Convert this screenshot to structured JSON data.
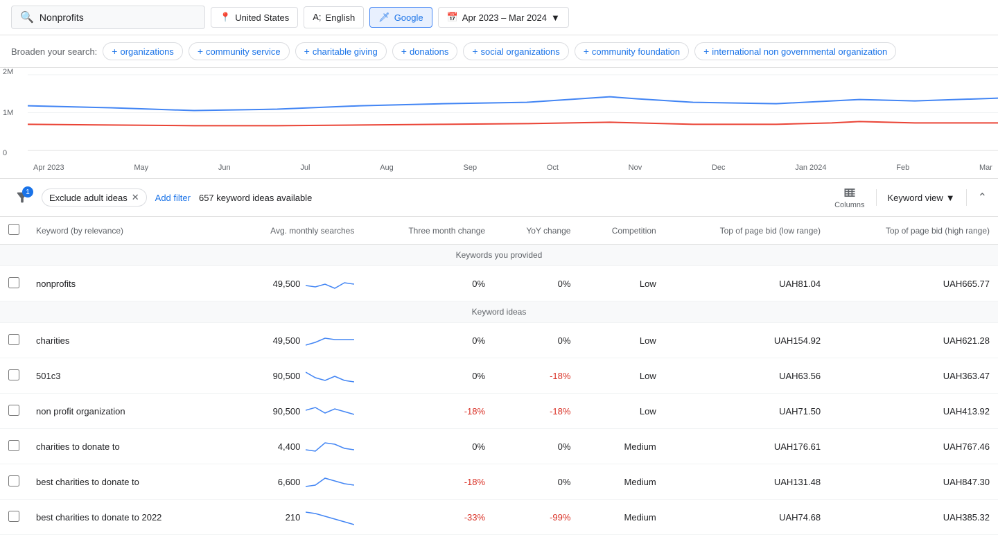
{
  "topbar": {
    "search_placeholder": "Nonprofits",
    "location": "United States",
    "language": "English",
    "platform": "Google",
    "date_range": "Apr 2023 – Mar 2024"
  },
  "broaden": {
    "label": "Broaden your search:",
    "chips": [
      "organizations",
      "community service",
      "charitable giving",
      "donations",
      "social organizations",
      "community foundation",
      "international non governmental organization"
    ]
  },
  "chart": {
    "y_labels": [
      "2M",
      "1M",
      "0"
    ],
    "x_labels": [
      "Apr 2023",
      "May",
      "Jun",
      "Jul",
      "Aug",
      "Sep",
      "Oct",
      "Nov",
      "Dec",
      "Jan 2024",
      "Feb",
      "Mar"
    ]
  },
  "toolbar": {
    "filter_badge": "1",
    "exclude_label": "Exclude adult ideas",
    "add_filter_label": "Add filter",
    "keyword_count": "657 keyword ideas available",
    "columns_label": "Columns",
    "keyword_view_label": "Keyword view"
  },
  "table": {
    "headers": [
      "",
      "Keyword (by relevance)",
      "Avg. monthly searches",
      "Three month change",
      "YoY change",
      "Competition",
      "Top of page bid (low range)",
      "Top of page bid (high range)"
    ],
    "section_provided": "Keywords you provided",
    "section_ideas": "Keyword ideas",
    "rows_provided": [
      {
        "keyword": "nonprofits",
        "avg_monthly": "49,500",
        "three_month": "0%",
        "yoy": "0%",
        "competition": "Low",
        "bid_low": "UAH81.04",
        "bid_high": "UAH665.77",
        "trend": "flat_slight"
      }
    ],
    "rows_ideas": [
      {
        "keyword": "charities",
        "avg_monthly": "49,500",
        "three_month": "0%",
        "yoy": "0%",
        "competition": "Low",
        "bid_low": "UAH154.92",
        "bid_high": "UAH621.28",
        "trend": "rise_flat"
      },
      {
        "keyword": "501c3",
        "avg_monthly": "90,500",
        "three_month": "0%",
        "yoy": "-18%",
        "competition": "Low",
        "bid_low": "UAH63.56",
        "bid_high": "UAH363.47",
        "trend": "down_slight"
      },
      {
        "keyword": "non profit organization",
        "avg_monthly": "90,500",
        "three_month": "-18%",
        "yoy": "-18%",
        "competition": "Low",
        "bid_low": "UAH71.50",
        "bid_high": "UAH413.92",
        "trend": "wavy"
      },
      {
        "keyword": "charities to donate to",
        "avg_monthly": "4,400",
        "three_month": "0%",
        "yoy": "0%",
        "competition": "Medium",
        "bid_low": "UAH176.61",
        "bid_high": "UAH767.46",
        "trend": "peak"
      },
      {
        "keyword": "best charities to donate to",
        "avg_monthly": "6,600",
        "three_month": "-18%",
        "yoy": "0%",
        "competition": "Medium",
        "bid_low": "UAH131.48",
        "bid_high": "UAH847.30",
        "trend": "peak_small"
      },
      {
        "keyword": "best charities to donate to 2022",
        "avg_monthly": "210",
        "three_month": "-33%",
        "yoy": "-99%",
        "competition": "Medium",
        "bid_low": "UAH74.68",
        "bid_high": "UAH385.32",
        "trend": "decline"
      }
    ]
  }
}
